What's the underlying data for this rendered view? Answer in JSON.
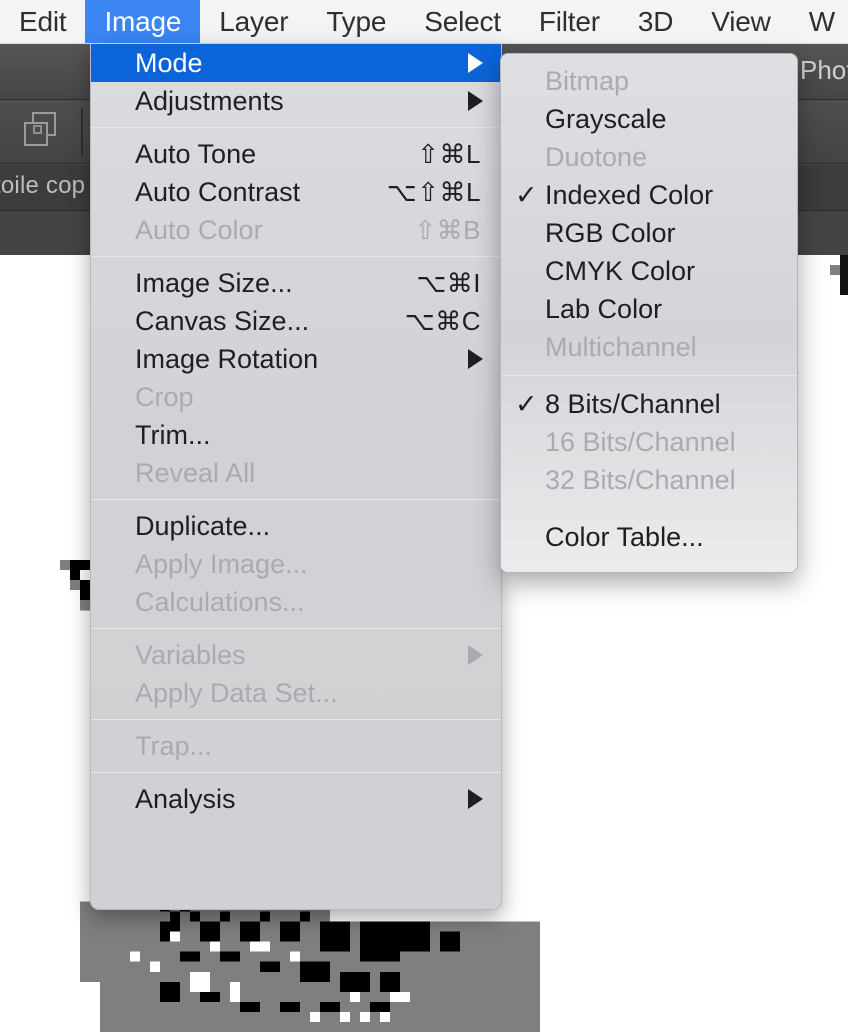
{
  "app": {
    "name_fragment": "Phot",
    "document_tab": "toile cop"
  },
  "menubar": {
    "items": [
      {
        "label": "Edit",
        "active": false
      },
      {
        "label": "Image",
        "active": true
      },
      {
        "label": "Layer",
        "active": false
      },
      {
        "label": "Type",
        "active": false
      },
      {
        "label": "Select",
        "active": false
      },
      {
        "label": "Filter",
        "active": false
      },
      {
        "label": "3D",
        "active": false
      },
      {
        "label": "View",
        "active": false
      },
      {
        "label": "W",
        "active": false
      }
    ],
    "highlight_color": "#3b86f3"
  },
  "image_menu": {
    "highlight_color": "#0b65d8",
    "groups": [
      {
        "items": [
          {
            "label": "Mode",
            "shortcut": "",
            "submenu": true,
            "selected": true,
            "disabled": false,
            "checked": false
          },
          {
            "label": "Adjustments",
            "shortcut": "",
            "submenu": true,
            "selected": false,
            "disabled": false,
            "checked": false
          }
        ]
      },
      {
        "items": [
          {
            "label": "Auto Tone",
            "shortcut": "⇧⌘L",
            "submenu": false,
            "selected": false,
            "disabled": false,
            "checked": false
          },
          {
            "label": "Auto Contrast",
            "shortcut": "⌥⇧⌘L",
            "submenu": false,
            "selected": false,
            "disabled": false,
            "checked": false
          },
          {
            "label": "Auto Color",
            "shortcut": "⇧⌘B",
            "submenu": false,
            "selected": false,
            "disabled": true,
            "checked": false
          }
        ]
      },
      {
        "items": [
          {
            "label": "Image Size...",
            "shortcut": "⌥⌘I",
            "submenu": false,
            "selected": false,
            "disabled": false,
            "checked": false
          },
          {
            "label": "Canvas Size...",
            "shortcut": "⌥⌘C",
            "submenu": false,
            "selected": false,
            "disabled": false,
            "checked": false
          },
          {
            "label": "Image Rotation",
            "shortcut": "",
            "submenu": true,
            "selected": false,
            "disabled": false,
            "checked": false
          },
          {
            "label": "Crop",
            "shortcut": "",
            "submenu": false,
            "selected": false,
            "disabled": true,
            "checked": false
          },
          {
            "label": "Trim...",
            "shortcut": "",
            "submenu": false,
            "selected": false,
            "disabled": false,
            "checked": false
          },
          {
            "label": "Reveal All",
            "shortcut": "",
            "submenu": false,
            "selected": false,
            "disabled": true,
            "checked": false
          }
        ]
      },
      {
        "items": [
          {
            "label": "Duplicate...",
            "shortcut": "",
            "submenu": false,
            "selected": false,
            "disabled": false,
            "checked": false
          },
          {
            "label": "Apply Image...",
            "shortcut": "",
            "submenu": false,
            "selected": false,
            "disabled": true,
            "checked": false
          },
          {
            "label": "Calculations...",
            "shortcut": "",
            "submenu": false,
            "selected": false,
            "disabled": true,
            "checked": false
          }
        ]
      },
      {
        "items": [
          {
            "label": "Variables",
            "shortcut": "",
            "submenu": true,
            "selected": false,
            "disabled": true,
            "checked": false
          },
          {
            "label": "Apply Data Set...",
            "shortcut": "",
            "submenu": false,
            "selected": false,
            "disabled": true,
            "checked": false
          }
        ]
      },
      {
        "items": [
          {
            "label": "Trap...",
            "shortcut": "",
            "submenu": false,
            "selected": false,
            "disabled": true,
            "checked": false
          }
        ]
      },
      {
        "items": [
          {
            "label": "Analysis",
            "shortcut": "",
            "submenu": true,
            "selected": false,
            "disabled": false,
            "checked": false
          }
        ]
      }
    ]
  },
  "mode_submenu": {
    "groups": [
      {
        "items": [
          {
            "label": "Bitmap",
            "shortcut": "",
            "submenu": false,
            "selected": false,
            "disabled": true,
            "checked": false
          },
          {
            "label": "Grayscale",
            "shortcut": "",
            "submenu": false,
            "selected": false,
            "disabled": false,
            "checked": false
          },
          {
            "label": "Duotone",
            "shortcut": "",
            "submenu": false,
            "selected": false,
            "disabled": true,
            "checked": false
          },
          {
            "label": "Indexed Color",
            "shortcut": "",
            "submenu": false,
            "selected": false,
            "disabled": false,
            "checked": true
          },
          {
            "label": "RGB Color",
            "shortcut": "",
            "submenu": false,
            "selected": false,
            "disabled": false,
            "checked": false
          },
          {
            "label": "CMYK Color",
            "shortcut": "",
            "submenu": false,
            "selected": false,
            "disabled": false,
            "checked": false
          },
          {
            "label": "Lab Color",
            "shortcut": "",
            "submenu": false,
            "selected": false,
            "disabled": false,
            "checked": false
          },
          {
            "label": "Multichannel",
            "shortcut": "",
            "submenu": false,
            "selected": false,
            "disabled": true,
            "checked": false
          }
        ]
      },
      {
        "items": [
          {
            "label": "8 Bits/Channel",
            "shortcut": "",
            "submenu": false,
            "selected": false,
            "disabled": false,
            "checked": true
          },
          {
            "label": "16 Bits/Channel",
            "shortcut": "",
            "submenu": false,
            "selected": false,
            "disabled": true,
            "checked": false
          },
          {
            "label": "32 Bits/Channel",
            "shortcut": "",
            "submenu": false,
            "selected": false,
            "disabled": true,
            "checked": false
          }
        ]
      },
      {
        "items": [
          {
            "label": "Color Table...",
            "shortcut": "",
            "submenu": false,
            "selected": false,
            "disabled": false,
            "checked": false
          }
        ]
      }
    ]
  },
  "checkmark_glyph": "✓"
}
